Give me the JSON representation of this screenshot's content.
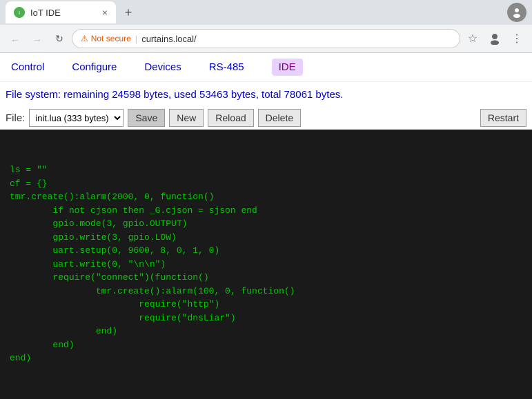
{
  "browser": {
    "tab": {
      "favicon_text": "I",
      "title": "IoT IDE",
      "close_label": "×"
    },
    "new_tab_label": "+",
    "profile_icon": "👤",
    "address": {
      "security_text": "Not secure",
      "separator": "|",
      "url": "curtains.local/",
      "back_label": "←",
      "forward_label": "→",
      "refresh_label": "↻",
      "star_label": "☆",
      "menu_label": "⋮"
    }
  },
  "nav": {
    "control_label": "Control",
    "configure_label": "Configure",
    "devices_label": "Devices",
    "rs485_label": "RS-485",
    "ide_label": "IDE"
  },
  "filesystem": {
    "text": "File system: remaining 24598 bytes, used 53463 bytes, total 78061 bytes."
  },
  "file_bar": {
    "label": "File:",
    "select_option": "init.lua (333 bytes)",
    "save_label": "Save",
    "new_label": "New",
    "reload_label": "Reload",
    "delete_label": "Delete",
    "restart_label": "Restart"
  },
  "code": {
    "content": "ls = \"\"\ncf = {}\ntmr.create():alarm(2000, 0, function()\n        if not cjson then _G.cjson = sjson end\n        gpio.mode(3, gpio.OUTPUT)\n        gpio.write(3, gpio.LOW)\n        uart.setup(0, 9600, 8, 0, 1, 0)\n        uart.write(0, \"\\n\\n\")\n        require(\"connect\")(function()\n                tmr.create():alarm(100, 0, function()\n                        require(\"http\")\n                        require(\"dnsLiar\")\n                end)\n        end)\nend)"
  }
}
